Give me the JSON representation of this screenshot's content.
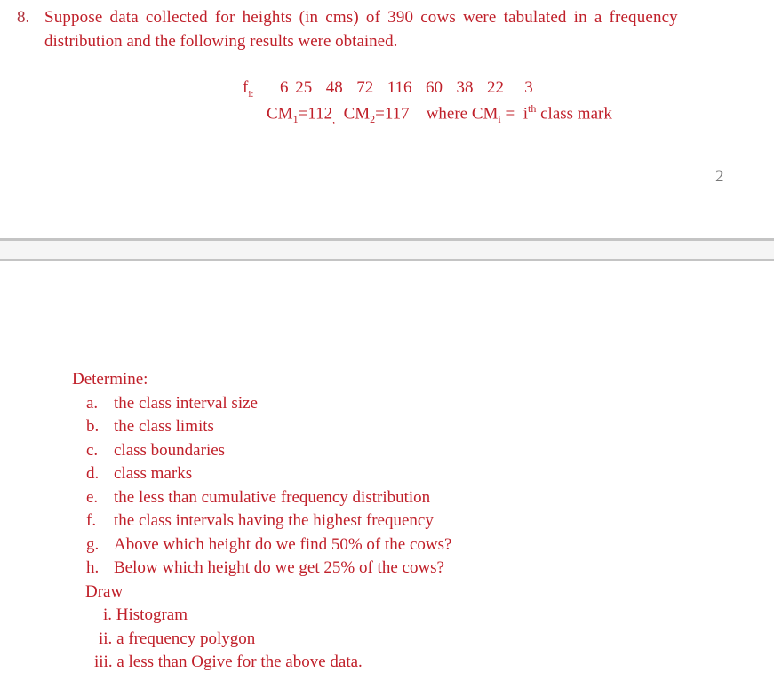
{
  "question": {
    "number": "8.",
    "line1": "Suppose data collected for heights (in cms) of 390 cows were tabulated in a frequency",
    "line2": "distribution and the following results were obtained.",
    "fi_label": "f",
    "fi_sub": "i:",
    "frequencies": "6 25  48  72  116  60  38  22   3",
    "cm1_label": "CM",
    "cm1_sub": "1",
    "cm1_val": "=112",
    "comma": ",",
    "cm2_label": "CM",
    "cm2_sub": "2",
    "cm2_val": "=117",
    "where_text": "where CM",
    "where_sub": "i",
    "where_eq": " =  i",
    "where_sup": "th",
    "where_end": " class mark"
  },
  "page_number": "2",
  "determine": {
    "heading": "Determine:",
    "items": [
      {
        "label": "a.",
        "text": "the class interval size"
      },
      {
        "label": "b.",
        "text": "the class limits"
      },
      {
        "label": "c.",
        "text": "class boundaries"
      },
      {
        "label": "d.",
        "text": "class marks"
      },
      {
        "label": "e.",
        "text": "the less than cumulative frequency distribution"
      },
      {
        "label": "f.",
        "text": "the class intervals having the highest frequency"
      },
      {
        "label": "g.",
        "text": "Above which height do we find 50% of the cows?"
      },
      {
        "label": "h.",
        "text": "Below which height do we get 25% of the cows?"
      }
    ]
  },
  "draw": {
    "heading": "Draw",
    "items": [
      {
        "label": "i.",
        "text": "Histogram"
      },
      {
        "label": "ii.",
        "text": "a frequency polygon"
      },
      {
        "label": "iii.",
        "text": "a less than Ogive for the above data."
      }
    ]
  },
  "colors": {
    "text": "#c0202a",
    "page_number": "#777777",
    "page_gap": "#f5f5f5",
    "page_gap_border": "#c4c4c4"
  }
}
